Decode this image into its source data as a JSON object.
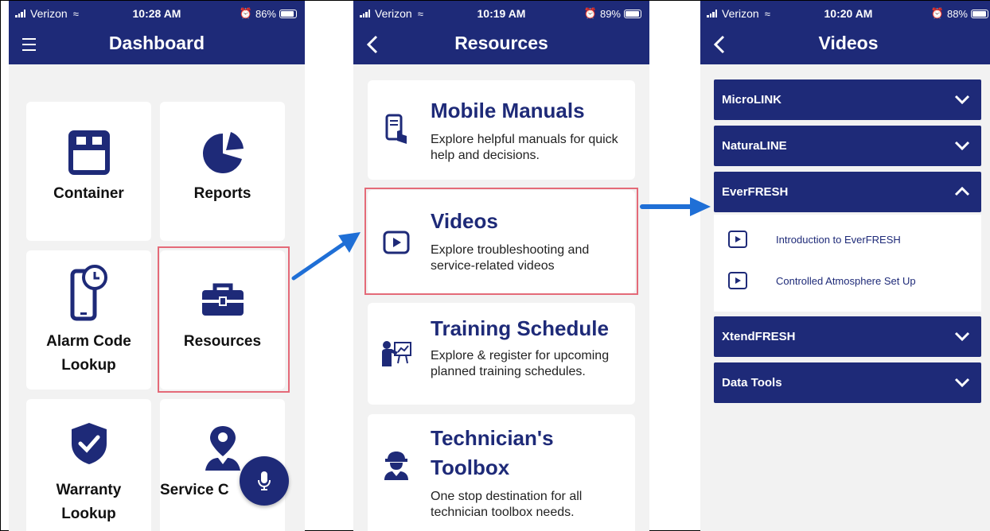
{
  "colors": {
    "brand": "#1e2a78",
    "highlight": "#e46a78",
    "arrow": "#1f6fd6",
    "background": "#f2f2f2"
  },
  "screens": [
    {
      "status": {
        "carrier": "Verizon",
        "time": "10:28 AM",
        "battery": "86%",
        "battery_level": 0.86
      },
      "appbar": {
        "title": "Dashboard",
        "left_icon": "menu-icon"
      },
      "tiles": [
        {
          "label": "Container",
          "icon": "container-icon"
        },
        {
          "label": "Reports",
          "icon": "pie-chart-icon"
        },
        {
          "label_line1": "Alarm Code",
          "label_line2": "Lookup",
          "icon": "alarm-phone-icon"
        },
        {
          "label": "Resources",
          "icon": "toolbox-icon"
        },
        {
          "label_line1": "Warranty",
          "label_line2": "Lookup",
          "icon": "shield-check-icon"
        },
        {
          "label": "Service C",
          "icon": "location-person-icon"
        }
      ],
      "fab": {
        "icon": "microphone-icon"
      }
    },
    {
      "status": {
        "carrier": "Verizon",
        "time": "10:19 AM",
        "battery": "89%",
        "battery_level": 0.89
      },
      "appbar": {
        "title": "Resources",
        "left_icon": "back-icon"
      },
      "cards": [
        {
          "title": "Mobile Manuals",
          "description": "Explore helpful manuals for quick help and decisions.",
          "icon": "phone-tap-icon"
        },
        {
          "title": "Videos",
          "description": "Explore troubleshooting and service-related videos",
          "icon": "play-icon"
        },
        {
          "title": "Training Schedule",
          "description": "Explore & register for upcoming planned training schedules.",
          "icon": "presenter-icon"
        },
        {
          "title_line1": "Technician's",
          "title_line2": "Toolbox",
          "description": "One stop destination for all technician toolbox needs.",
          "icon": "technician-icon"
        }
      ]
    },
    {
      "status": {
        "carrier": "Verizon",
        "time": "10:20 AM",
        "battery": "88%",
        "battery_level": 0.88
      },
      "appbar": {
        "title": "Videos",
        "left_icon": "back-icon"
      },
      "sections": [
        {
          "label": "MicroLINK",
          "expanded": false
        },
        {
          "label": "NaturaLINE",
          "expanded": false
        },
        {
          "label": "EverFRESH",
          "expanded": true,
          "items": [
            "Introduction to EverFRESH",
            "Controlled Atmosphere Set Up"
          ]
        },
        {
          "label": "XtendFRESH",
          "expanded": false
        },
        {
          "label": "Data Tools",
          "expanded": false
        }
      ]
    }
  ]
}
